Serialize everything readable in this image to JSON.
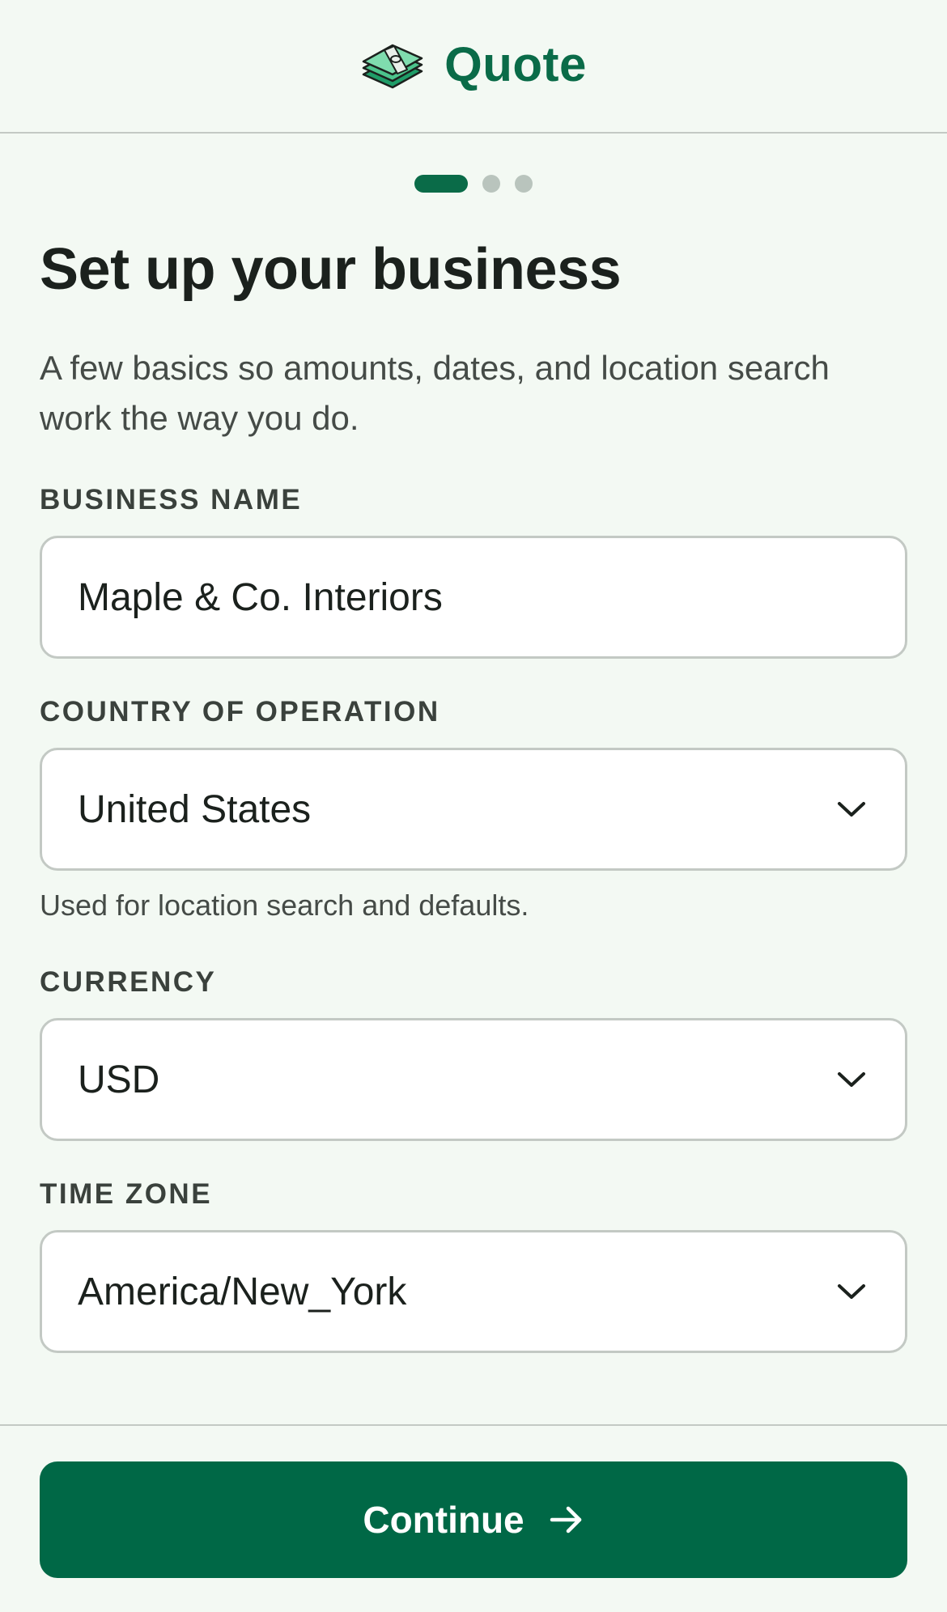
{
  "header": {
    "brand_icon": "money-stack-icon",
    "brand_name": "Quote"
  },
  "stepper": {
    "current_step": 1,
    "total_steps": 3
  },
  "page": {
    "title": "Set up your business",
    "subtitle": "A few basics so amounts, dates, and location search work the way you do."
  },
  "form": {
    "business_name": {
      "label": "BUSINESS NAME",
      "value": "Maple & Co. Interiors"
    },
    "country": {
      "label": "COUNTRY OF OPERATION",
      "value": "United States",
      "helper": "Used for location search and defaults."
    },
    "currency": {
      "label": "CURRENCY",
      "value": "USD"
    },
    "time_zone": {
      "label": "TIME ZONE",
      "value": "America/New_York"
    }
  },
  "footer": {
    "continue_label": "Continue",
    "continue_icon": "arrow-right-icon"
  },
  "colors": {
    "brand": "#0a6b48",
    "button": "#006846",
    "background": "#f3f9f3",
    "border": "#c3c9c4"
  }
}
